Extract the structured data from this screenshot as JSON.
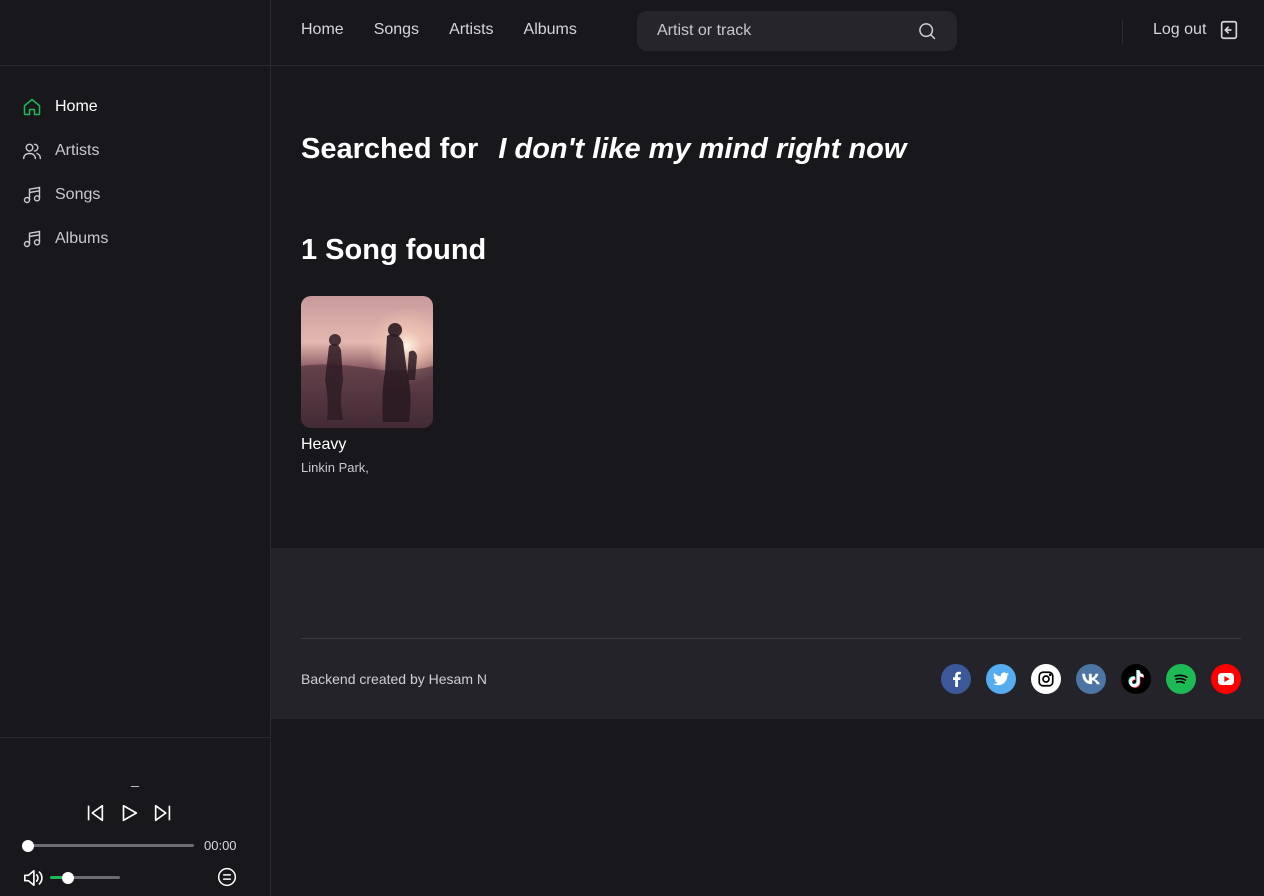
{
  "sidebar": {
    "items": [
      {
        "label": "Home",
        "icon": "home-icon",
        "active": true
      },
      {
        "label": "Artists",
        "icon": "users-icon"
      },
      {
        "label": "Songs",
        "icon": "music-note-icon"
      },
      {
        "label": "Albums",
        "icon": "music-note-icon"
      }
    ],
    "accent": "#1db954"
  },
  "player": {
    "now_playing": "_",
    "time": "00:00",
    "progress": 0,
    "volume": 0.25
  },
  "header": {
    "links": [
      "Home",
      "Songs",
      "Artists",
      "Albums"
    ],
    "search_placeholder": "Artist or track",
    "logout_label": "Log out"
  },
  "main": {
    "searched_label": "Searched for",
    "query": "I don't like my mind right now",
    "found_label": "1 Song found",
    "songs": [
      {
        "title": "Heavy",
        "artist": "Linkin Park,"
      }
    ]
  },
  "footer": {
    "credit": "Backend created by Hesam N",
    "socials": [
      {
        "name": "facebook-icon",
        "color": "#3b5998"
      },
      {
        "name": "twitter-icon",
        "color": "#55acee"
      },
      {
        "name": "instagram-icon",
        "color": "#ffffff"
      },
      {
        "name": "vk-icon",
        "color": "#4c75a3"
      },
      {
        "name": "tiktok-icon",
        "color": "#000000"
      },
      {
        "name": "spotify-icon",
        "color": "#1db954"
      },
      {
        "name": "youtube-icon",
        "color": "#ff0000"
      }
    ]
  }
}
